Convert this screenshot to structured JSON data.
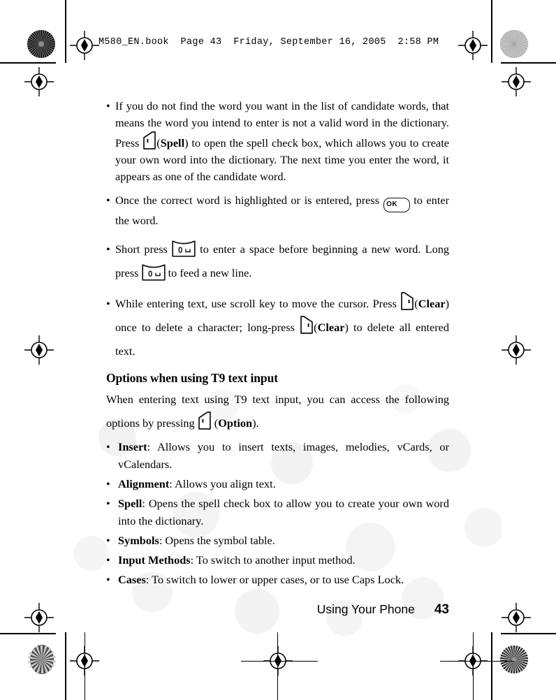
{
  "document": {
    "header": "M580_EN.book  Page 43  Friday, September 16, 2005  2:58 PM",
    "footer_title": "Using Your Phone",
    "page_number": "43"
  },
  "bullets": [
    {
      "id": "candidate-words",
      "part1": "If you do not find the word you want in the list of candidate words, that means the word you intend to enter is not a valid word in the dictionary. Press ",
      "key": "left-softkey",
      "key_label": "Spell",
      "part2": " to open the spell check box, which allows you to create your own word into the dictionary. The next time you enter the word, it appears as one of the candidate word."
    },
    {
      "id": "confirm-word",
      "part1": "Once the correct word is highlighted or is entered, press ",
      "key": "ok-key",
      "key_label": "OK",
      "part2": " to enter the word."
    },
    {
      "id": "space-newline",
      "part1": "Short press ",
      "key": "zero-key",
      "key_label": "0",
      "part2": " to enter a space before beginning a new word. Long press ",
      "key2": "zero-key",
      "part3": " to feed a new line."
    },
    {
      "id": "clear-text",
      "part1": "While entering text, use scroll key to move the cursor. Press ",
      "key": "right-softkey",
      "key_label": "Clear",
      "part2": " once to delete a character; long-press ",
      "key2": "right-softkey",
      "key2_label": "Clear",
      "part3": " to delete all entered text."
    }
  ],
  "section": {
    "heading": "Options when using T9 text input",
    "intro1": "When entering text using T9 text input, you can access the following options by pressing ",
    "intro_key": "left-softkey",
    "intro_key_label": "Option",
    "intro2": "."
  },
  "options": [
    {
      "name": "Insert",
      "desc": ": Allows you to insert texts, images, melodies, vCards, or vCalendars."
    },
    {
      "name": "Alignment",
      "desc": ": Allows you align text."
    },
    {
      "name": "Spell",
      "desc": ": Opens the spell check box to allow you to create your own word into the dictionary."
    },
    {
      "name": "Symbols",
      "desc": ": Opens the symbol table."
    },
    {
      "name": "Input Methods",
      "desc": ": To switch to another input method."
    },
    {
      "name": "Cases",
      "desc": ": To switch to lower or upper cases, or to use Caps Lock."
    }
  ],
  "keys": {
    "ok_text": "OK",
    "zero_text": "0",
    "zero_symbol": "⎵"
  },
  "colors": {
    "text": "#000000",
    "page": "#ffffff",
    "watermark": "#f0f0f0"
  }
}
